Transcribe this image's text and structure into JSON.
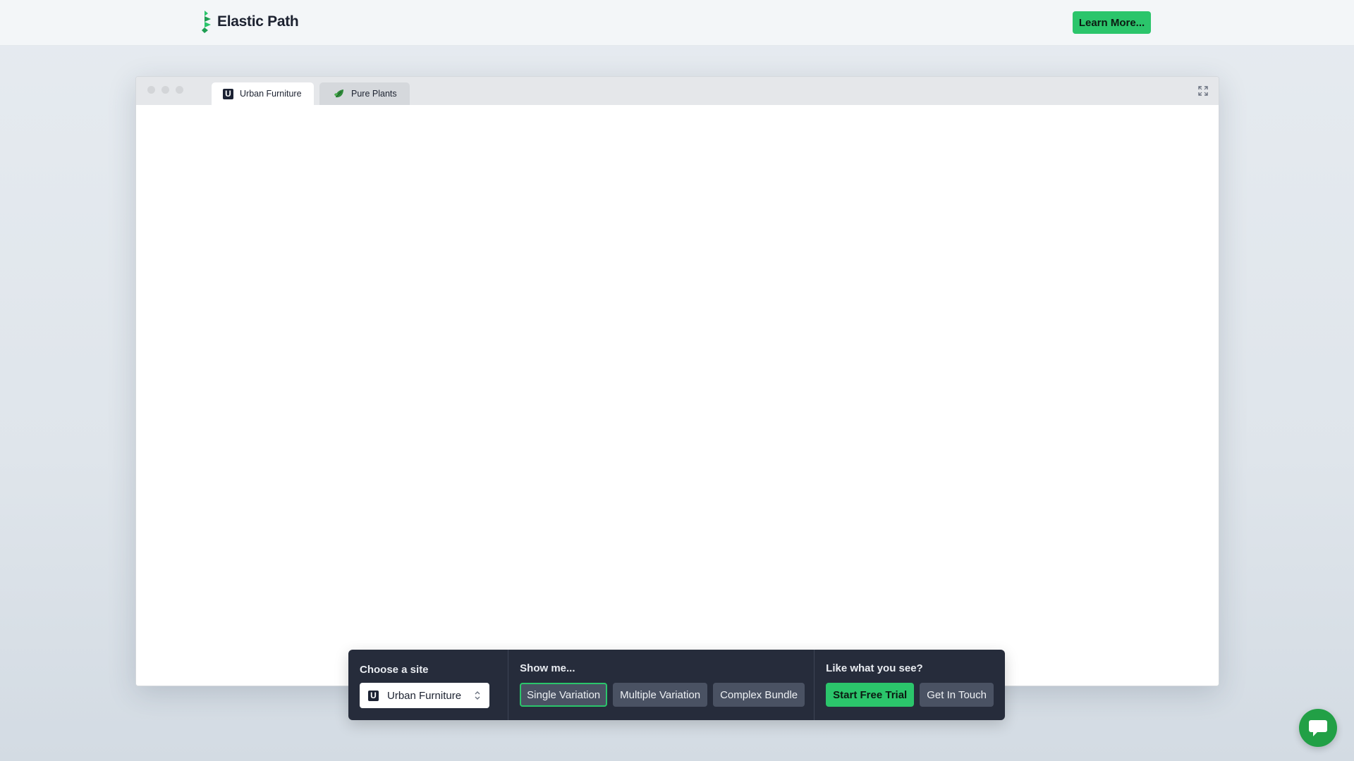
{
  "header": {
    "brand_name": "Elastic Path",
    "learn_more_label": "Learn More..."
  },
  "browser": {
    "tabs": [
      {
        "label": "Urban Furniture",
        "icon": "urban-furniture-logo-icon",
        "active": true
      },
      {
        "label": "Pure Plants",
        "icon": "leaf-icon",
        "active": false
      }
    ]
  },
  "panel": {
    "site": {
      "title": "Choose a site",
      "selected_value": "Urban Furniture",
      "icon_letter": "U"
    },
    "show": {
      "title": "Show me...",
      "options": [
        {
          "label": "Single Variation",
          "selected": true
        },
        {
          "label": "Multiple Variation",
          "selected": false
        },
        {
          "label": "Complex Bundle",
          "selected": false
        }
      ]
    },
    "like": {
      "title": "Like what you see?",
      "trial_label": "Start Free Trial",
      "contact_label": "Get In Touch"
    }
  },
  "colors": {
    "accent_green": "#2bc56b",
    "panel_bg": "#262c3b",
    "chat_green": "#22a046"
  }
}
